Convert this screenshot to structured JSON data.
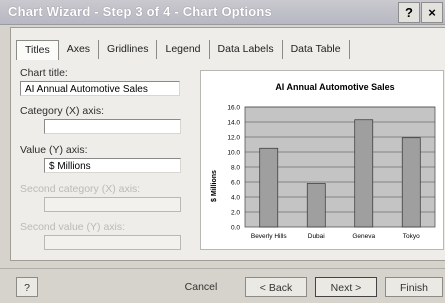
{
  "window": {
    "title": "Chart Wizard - Step 3 of 4 - Chart Options"
  },
  "titlebar": {
    "help_label": "?",
    "close_label": "×"
  },
  "tabs": [
    "Titles",
    "Axes",
    "Gridlines",
    "Legend",
    "Data Labels",
    "Data Table"
  ],
  "fields": {
    "chart_title": {
      "label": "Chart title:",
      "value": "AI Annual Automotive Sales"
    },
    "category_x": {
      "label": "Category (X) axis:",
      "value": ""
    },
    "value_y": {
      "label": "Value (Y) axis:",
      "value": "$ Millions"
    },
    "second_category": {
      "label": "Second category (X) axis:",
      "value": ""
    },
    "second_value": {
      "label": "Second value (Y) axis:",
      "value": ""
    }
  },
  "chart_data": {
    "type": "bar",
    "title": "AI Annual Automotive Sales",
    "ylabel": "$ Millions",
    "xlabel": "",
    "categories": [
      "Beverly Hills",
      "Dubai",
      "Geneva",
      "Tokyo"
    ],
    "values": [
      10.5,
      5.8,
      14.3,
      11.9
    ],
    "ylim": [
      0,
      16
    ],
    "yticks": [
      "0.0",
      "2.0",
      "4.0",
      "6.0",
      "8.0",
      "10.0",
      "12.0",
      "14.0",
      "16.0"
    ],
    "grid": true,
    "bar_color": "#9f9f9f",
    "plot_bg": "#c4c4c4"
  },
  "buttons": {
    "help": "?",
    "cancel": "Cancel",
    "back": "< Back",
    "next": "Next >",
    "finish": "Finish"
  }
}
